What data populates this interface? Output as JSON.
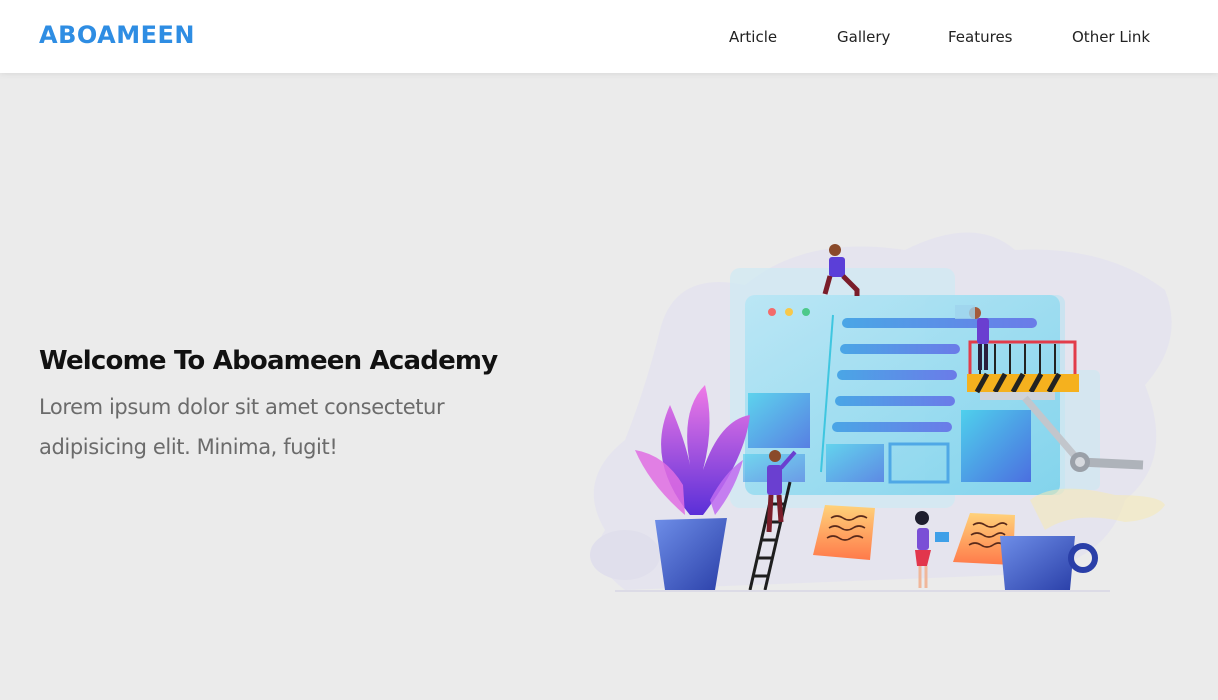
{
  "header": {
    "logo": "ABOAMEEN",
    "nav": [
      {
        "label": "Article"
      },
      {
        "label": "Gallery"
      },
      {
        "label": "Features"
      },
      {
        "label": "Other Link"
      }
    ]
  },
  "hero": {
    "title": "Welcome To Aboameen Academy",
    "text": "Lorem ipsum dolor sit amet consectetur adipisicing elit. Minima, fugit!"
  },
  "colors": {
    "brand": "#2e8de3",
    "background": "#ebebeb",
    "header_bg": "#ffffff",
    "body_text": "#6b6b6b"
  }
}
